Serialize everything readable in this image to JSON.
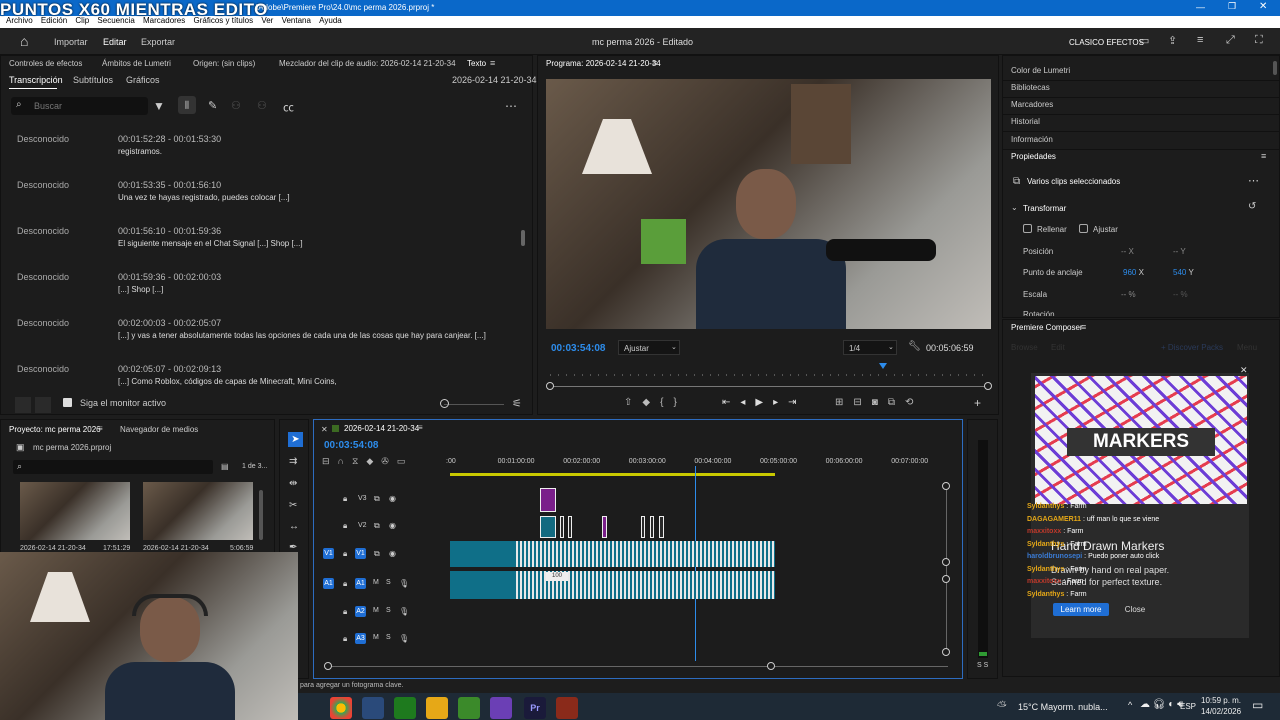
{
  "overlay_title": "PUNTOS X60 MIENTRAS EDITO",
  "titlebar": {
    "path": "\\Adobe\\Premiere Pro\\24.0\\mc perma 2026.prproj *"
  },
  "menu": [
    "Archivo",
    "Edición",
    "Clip",
    "Secuencia",
    "Marcadores",
    "Gráficos y títulos",
    "Ver",
    "Ventana",
    "Ayuda"
  ],
  "app_header": {
    "nav": [
      "Importar",
      "Editar",
      "Exportar"
    ],
    "project_title": "mc perma 2026",
    "status": "Editado",
    "workspace": "CLASICO EFECTOS"
  },
  "source_panel": {
    "tabs": [
      "Controles de efectos",
      "Ámbitos de Lumetri",
      "Origen: (sin clips)",
      "Mezclador del clip de audio: 2026-02-14 21-20-34",
      "Texto"
    ],
    "subtabs": [
      "Transcripción",
      "Subtítulos",
      "Gráficos"
    ],
    "sequence_name": "2026-02-14 21-20-34",
    "search_placeholder": "Buscar",
    "follow_monitor": "Siga el monitor activo",
    "rows": [
      {
        "speaker": "Desconocido",
        "time": "00:01:52:28 - 00:01:53:30",
        "text": "registramos."
      },
      {
        "speaker": "Desconocido",
        "time": "00:01:53:35 - 00:01:56:10",
        "text": "Una vez te hayas registrado, puedes colocar [...]"
      },
      {
        "speaker": "Desconocido",
        "time": "00:01:56:10 - 00:01:59:36",
        "text": "El siguiente mensaje en el Chat Signal [...] Shop [...]"
      },
      {
        "speaker": "Desconocido",
        "time": "00:01:59:36 - 00:02:00:03",
        "text": "[...] Shop [...]"
      },
      {
        "speaker": "Desconocido",
        "time": "00:02:00:03 - 00:02:05:07",
        "text": "[...] y vas a tener absolutamente todas las opciones de cada una de las cosas que hay para canjear. [...]"
      },
      {
        "speaker": "Desconocido",
        "time": "00:02:05:07 - 00:02:09:13",
        "text": "[...] Como Roblox, códigos de capas de Minecraft, Mini Coins,"
      }
    ]
  },
  "program": {
    "title": "Programa: 2026-02-14 21-20-34",
    "timecode": "00:03:54:08",
    "fit": "Ajustar",
    "resolution": "1/4",
    "duration": "00:05:06:59",
    "playhead": 0.76
  },
  "right_panel": {
    "items": [
      "Color de Lumetri",
      "Bibliotecas",
      "Marcadores",
      "Historial",
      "Información",
      "Propiedades"
    ],
    "selected": "Varios clips seleccionados",
    "transform": "Transformar",
    "fill": "Rellenar",
    "fit": "Ajustar",
    "position_label": "Posición",
    "position_x": "-- X",
    "position_y": "-- Y",
    "anchor_label": "Punto de anclaje",
    "anchor_x": "960",
    "anchor_y": "540",
    "x": "X",
    "y": "Y",
    "scale_label": "Escala",
    "scale_val": "-- %",
    "scale_val2": "-- %",
    "rotation_label": "Rotación"
  },
  "composer": {
    "title": "Premiere Composer",
    "tabs": [
      "Browse",
      "Edit"
    ],
    "discover": "+ Discover Packs",
    "menu": "Menu",
    "banner_text": "MARKERS",
    "product_title": "Hand Drawn Markers",
    "product_desc1": "Drawn by hand on real paper.",
    "product_desc2": "Scanned for perfect texture.",
    "learn_more": "Learn more",
    "close": "Close",
    "chat": [
      {
        "user": "Syldanthys",
        "msg": "Farm",
        "color": "#e6a817"
      },
      {
        "user": "DAGAGAMER11",
        "msg": "uff man lo que se viene",
        "color": "#e6a817"
      },
      {
        "user": "maxxitoxx",
        "msg": "Farm",
        "color": "#c0392b"
      },
      {
        "user": "Syldanthys",
        "msg": "Farm",
        "color": "#e6a817"
      },
      {
        "user": "haroldbrunosepi",
        "msg": "Puedo poner auto click",
        "color": "#3a7bd5"
      },
      {
        "user": "Syldanthys",
        "msg": "Farm",
        "color": "#e6a817"
      },
      {
        "user": "maxxitoxx",
        "msg": "Farm",
        "color": "#c0392b"
      },
      {
        "user": "Syldanthys",
        "msg": "Farm",
        "color": "#e6a817"
      }
    ]
  },
  "project": {
    "tabs": [
      "Proyecto: mc perma 2026",
      "Navegador de medios"
    ],
    "file": "mc perma 2026.prproj",
    "count": "1 de 3...",
    "thumbs": [
      {
        "name": "2026-02-14 21-20-34",
        "dur": "17:51:29"
      },
      {
        "name": "2026-02-14 21-20-34",
        "dur": "5:06:59"
      }
    ]
  },
  "timeline": {
    "name": "2026-02-14 21-20-34",
    "timecode": "00:03:54:08",
    "ruler": [
      ":00",
      "00:01:00:00",
      "00:02:00:00",
      "00:03:00:00",
      "00:04:00:00",
      "00:05:00:00",
      "00:06:00:00",
      "00:07:00:00"
    ],
    "tracks": [
      "V3",
      "V2",
      "V1",
      "A1",
      "A2",
      "A3"
    ],
    "clip_label": "100"
  },
  "status_bar": "para agregar un fotograma clave.",
  "taskbar": {
    "weather": "15°C  Mayorm. nubla...",
    "lang": "ESP",
    "time": "10:59 p. m.",
    "date": "14/02/2026"
  }
}
